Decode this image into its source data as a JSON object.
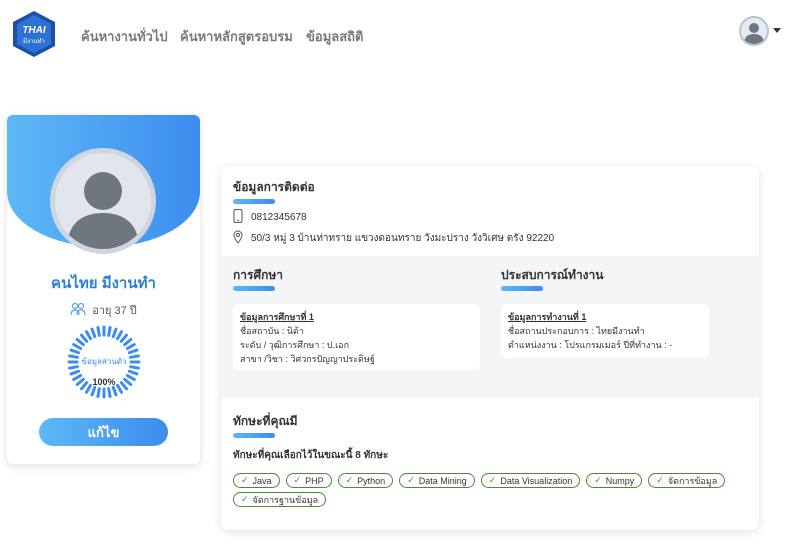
{
  "nav": {
    "logo_text_top": "THAI",
    "logo_text_bottom": "มีงานทำ",
    "links": [
      "ค้นหางานทั่วไป",
      "ค้นหาหลักสูตรอบรม",
      "ข้อมูลสถิติ"
    ]
  },
  "profile": {
    "name": "คนไทย มีงานทำ",
    "age": "อายุ 37 ปี",
    "progress_label": "ข้อมูลส่วนตัว",
    "progress_value": "100%",
    "progress_fraction": 1.0,
    "edit_label": "แก้ไข"
  },
  "contact": {
    "title": "ข้อมูลการติดต่อ",
    "phone": "0812345678",
    "address": "50/3 หมู่ 3 บ้านท่าทราย แขวงดอนทราย วังมะปราง วังวิเศษ ตรัง 92220"
  },
  "education": {
    "title": "การศึกษา",
    "box_title": "ข้อมูลการศึกษาที่ 1",
    "lines": [
      "ชื่อสถาบัน : นิด้า",
      "ระดับ / วุฒิการศึกษา : ป.เอก",
      "สาขา /วิชา : วิศวกรปัญญาประดิษฐ์"
    ]
  },
  "experience": {
    "title": "ประสบการณ์ทำงาน",
    "box_title": "ข้อมูลการทำงานที่ 1",
    "lines": [
      "ชื่อสถานประกอบการ : ไทยมีงานทำ",
      "ตำแหน่งงาน : โปรแกรมเมอร์   ปีที่ทำงาน : -"
    ]
  },
  "skills": {
    "title": "ทักษะที่คุณมี",
    "count_text": "ทักษะที่คุณเลือกไว้ในขณะนี้ 8 ทักษะ",
    "items": [
      "Java",
      "PHP",
      "Python",
      "Data Mining",
      "Data Visualization",
      "Numpy",
      "จัดการข้อมูล",
      "จัดการฐานข้อมูล"
    ]
  },
  "colors": {
    "accent": "#3d8cf0",
    "accent_light": "#5db8f5",
    "chip_border": "#4a8a3a"
  }
}
